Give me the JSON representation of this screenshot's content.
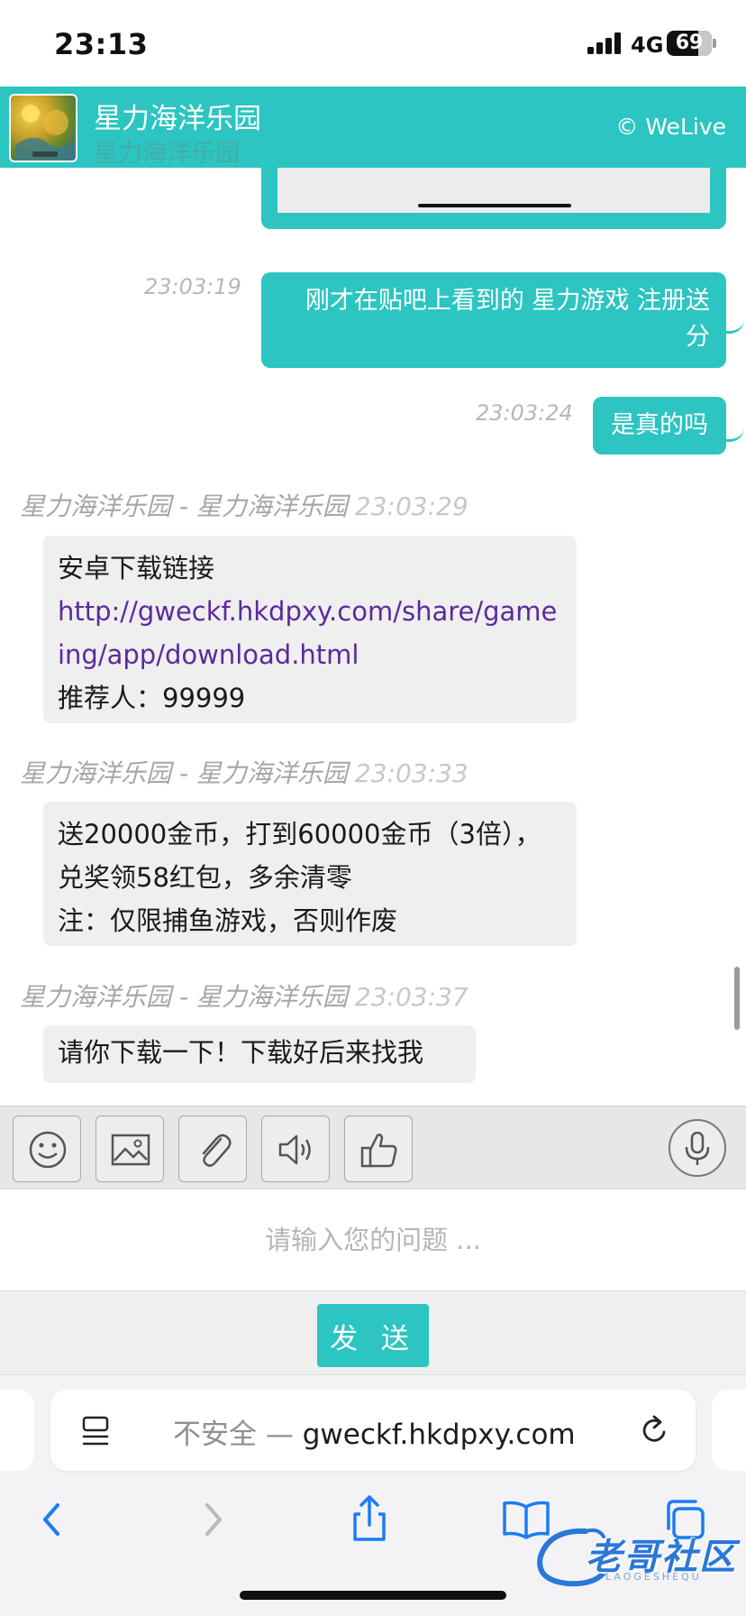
{
  "status_bar": {
    "time": "23:13",
    "network": "4G",
    "battery_percent": "69",
    "battery_level": 0.69
  },
  "header": {
    "title": "星力海洋乐园",
    "subtitle": "星力海洋乐园",
    "brand": "© WeLive",
    "avatar_icon": "game-avatar"
  },
  "messages": {
    "sent": [
      {
        "time": "23:03:19",
        "text": "刚才在贴吧上看到的 星力游戏 注册送分"
      },
      {
        "time": "23:03:24",
        "text": "是真的吗"
      }
    ],
    "received": [
      {
        "sender": "星力海洋乐园 - 星力海洋乐园",
        "time": "23:03:29",
        "line1": "安卓下载链接",
        "link": "http://gweckf.hkdpxy.com/share/gameing/app/download.html",
        "line3": "推荐人：99999"
      },
      {
        "sender": "星力海洋乐园 - 星力海洋乐园",
        "time": "23:03:33",
        "line1": "送20000金币，打到60000金币（3倍），兑奖领58红包，多余清零",
        "line2": "注：仅限捕鱼游戏，否则作废"
      },
      {
        "sender": "星力海洋乐园 - 星力海洋乐园",
        "time": "23:03:37",
        "line1": "请你下载一下！下载好后来找我"
      }
    ]
  },
  "toolbar": {
    "icons": [
      "smiley-icon",
      "image-icon",
      "paperclip-icon",
      "speaker-icon",
      "thumbs-up-icon",
      "microphone-icon"
    ]
  },
  "composer": {
    "placeholder": "请输入您的问题 ...",
    "value": "",
    "send_label": "发 送"
  },
  "safari": {
    "insecure_label": "不安全 —",
    "domain": "gweckf.hkdpxy.com"
  },
  "watermark": {
    "text": "老哥社区",
    "sub": "LAOGESHEQU"
  },
  "colors": {
    "accent": "#2cc5c1",
    "link": "#5b2a9c",
    "agent_bubble": "#efefef"
  }
}
